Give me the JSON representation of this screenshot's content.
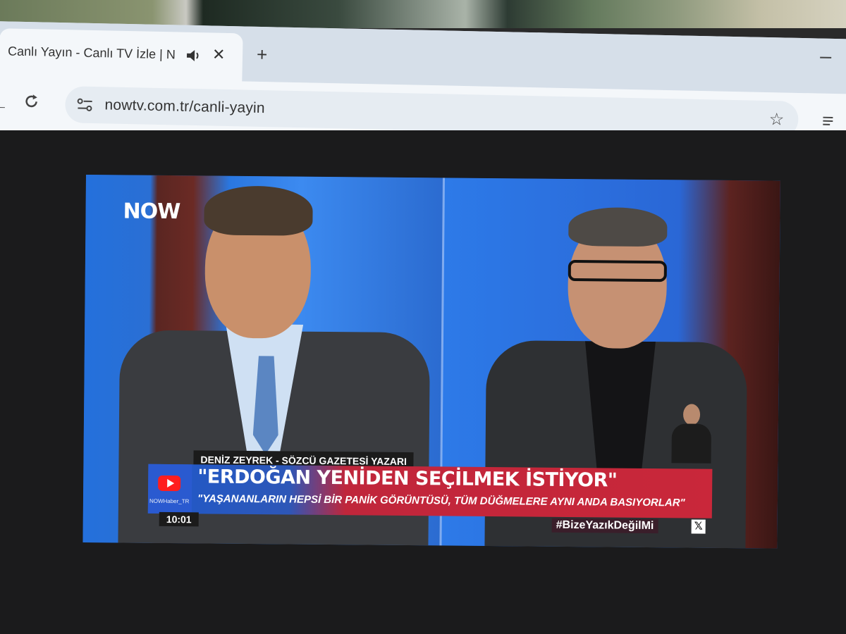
{
  "browser": {
    "tab": {
      "title": "Canlı Yayın - Canlı TV İzle | N",
      "audio_icon": "speaker-icon",
      "close_glyph": "✕"
    },
    "new_tab_glyph": "+",
    "url": "nowtv.com.tr/canli-yayin"
  },
  "broadcast": {
    "channel_logo": "NOW",
    "name_plate": "DENİZ ZEYREK - SÖZCÜ GAZETESİ YAZARI",
    "headline": "\"ERDOĞAN YENİDEN SEÇİLMEK İSTİYOR\"",
    "sub_headline": "\"YAŞANANLARIN HEPSİ BİR PANİK GÖRÜNTÜSÜ, TÜM DÜĞMELERE AYNI ANDA BASIYORLAR\"",
    "youtube_handle": "NOWHaber_TR",
    "clock": "10:01",
    "hashtag": "#BizeYazıkDeğilMi",
    "social_icon": "x-logo-icon"
  },
  "colors": {
    "studio_blue": "#1d5fc5",
    "headline_red": "#c9273a",
    "browser_bg": "#f4f7fa"
  }
}
